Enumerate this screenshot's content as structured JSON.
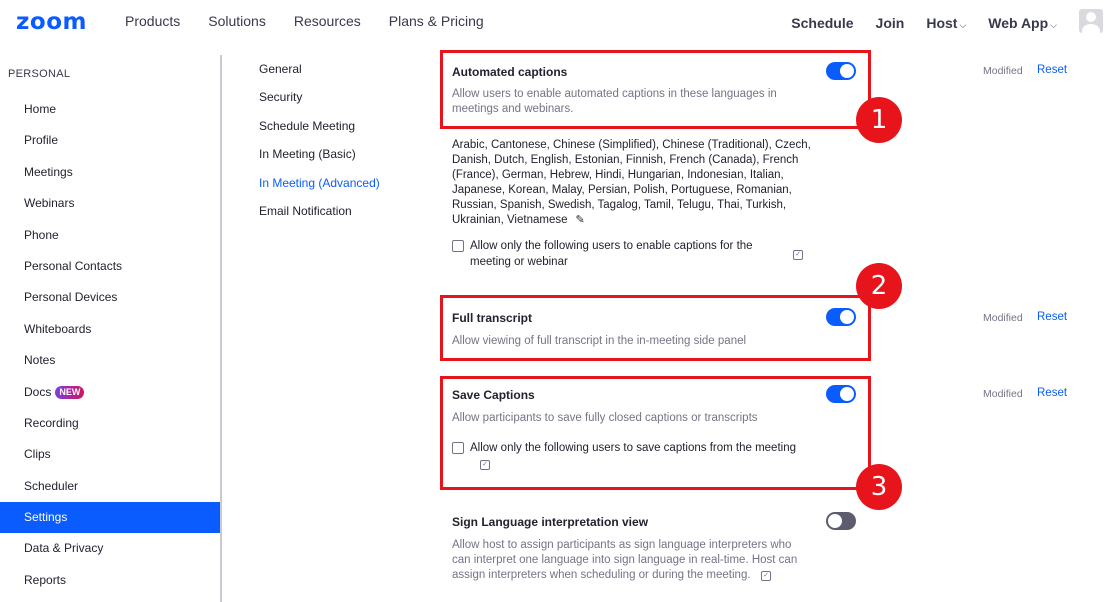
{
  "brand": {
    "logo": "zoom",
    "accent": "#0b5cff",
    "annotation_color": "#e8141c"
  },
  "topnav": {
    "left": [
      "Products",
      "Solutions",
      "Resources",
      "Plans & Pricing"
    ],
    "schedule": "Schedule",
    "join": "Join",
    "host": "Host",
    "webapp": "Web App",
    "caret": "⌵",
    "avatar_icon": "user-avatar-icon"
  },
  "sidebar": {
    "heading": "PERSONAL",
    "items": [
      {
        "label": "Home"
      },
      {
        "label": "Profile"
      },
      {
        "label": "Meetings"
      },
      {
        "label": "Webinars"
      },
      {
        "label": "Phone"
      },
      {
        "label": "Personal Contacts"
      },
      {
        "label": "Personal Devices"
      },
      {
        "label": "Whiteboards"
      },
      {
        "label": "Notes"
      },
      {
        "label": "Docs",
        "badge": "NEW"
      },
      {
        "label": "Recording"
      },
      {
        "label": "Clips"
      },
      {
        "label": "Scheduler"
      },
      {
        "label": "Settings",
        "active": true
      },
      {
        "label": "Data & Privacy"
      },
      {
        "label": "Reports"
      }
    ]
  },
  "subnav": [
    {
      "label": "General"
    },
    {
      "label": "Security"
    },
    {
      "label": "Schedule Meeting"
    },
    {
      "label": "In Meeting (Basic)"
    },
    {
      "label": "In Meeting (Advanced)",
      "active": true
    },
    {
      "label": "Email Notification"
    }
  ],
  "settings": {
    "automated_captions": {
      "title": "Automated captions",
      "desc": "Allow users to enable automated captions in these languages in meetings and webinars.",
      "enabled": true,
      "status": "Modified",
      "reset": "Reset",
      "languages": "Arabic, Cantonese, Chinese (Simplified), Chinese (Traditional), Czech, Danish, Dutch, English, Estonian, Finnish, French (Canada), French (France), German, Hebrew, Hindi, Hungarian, Indonesian, Italian, Japanese, Korean, Malay, Persian, Polish, Portuguese, Romanian, Russian, Spanish, Swedish, Tagalog, Tamil, Telugu, Thai, Turkish, Ukrainian, Vietnamese",
      "edit_icon": "pencil-icon",
      "checkbox_label": "Allow only the following users to enable captions for the meeting or webinar",
      "checked": false
    },
    "full_transcript": {
      "title": "Full transcript",
      "desc": "Allow viewing of full transcript in the in-meeting side panel",
      "enabled": true,
      "status": "Modified",
      "reset": "Reset"
    },
    "save_captions": {
      "title": "Save Captions",
      "desc": "Allow participants to save fully closed captions or transcripts",
      "enabled": true,
      "status": "Modified",
      "reset": "Reset",
      "checkbox_label": "Allow only the following users to save captions from the meeting",
      "checked": false
    },
    "sign_language": {
      "title": "Sign Language interpretation view",
      "desc": "Allow host to assign participants as sign language interpreters who can interpret one language into sign language in real-time. Host can assign interpreters when scheduling or during the meeting.",
      "enabled": false
    }
  },
  "annotations": [
    "1",
    "2",
    "3"
  ]
}
